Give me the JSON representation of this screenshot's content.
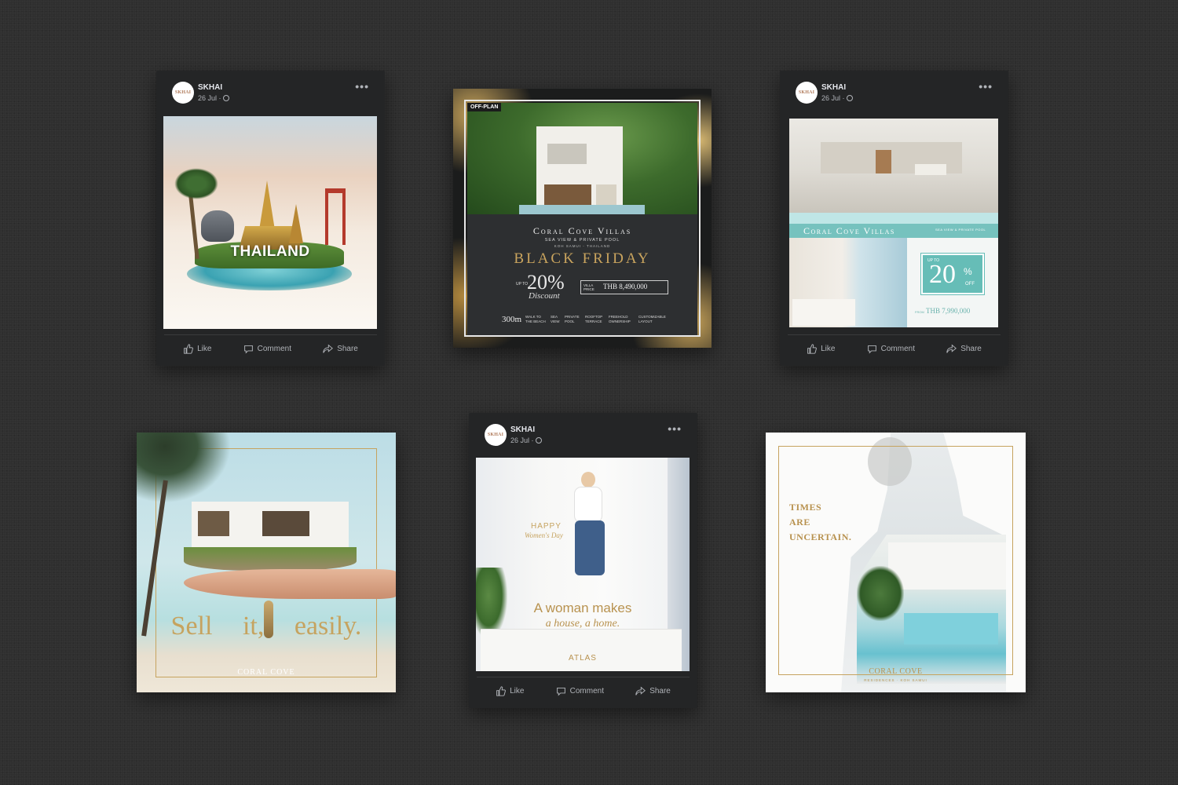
{
  "posts": {
    "thailand": {
      "page_name": "SKHAI",
      "avatar_text": "SKHAI",
      "date": "26 Jul ·",
      "banner_text": "THAILAND",
      "actions": {
        "like": "Like",
        "comment": "Comment",
        "share": "Share"
      }
    },
    "black_friday": {
      "tag": "OFF-PLAN",
      "brand": "Coral Cove Villas",
      "subtitle": "SEA VIEW & PRIVATE POOL",
      "location": "KOH SAMUI - THAILAND",
      "headline": "BLACK FRIDAY",
      "up_to": "UP TO",
      "discount": "20%",
      "discount_word": "Discount",
      "price_label": "VILLA PRICE",
      "price": "THB 8,490,000",
      "distance": "300m",
      "features": [
        "WALK TO THE BEACH",
        "SEA VIEW",
        "PRIVATE POOL",
        "ROOFTOP TERRACE",
        "FREEHOLD OWNERSHIP",
        "CUSTOMIZABLE LAYOUT"
      ]
    },
    "coral_interior": {
      "page_name": "SKHAI",
      "avatar_text": "SKHAI",
      "date": "26 Jul ·",
      "brand": "Coral Cove Villas",
      "subtitle": "SEA VIEW & PRIVATE POOL",
      "up_to": "UP TO",
      "discount": "20",
      "percent": "%",
      "off": "OFF",
      "price_from": "FROM",
      "price": "THB 7,990,000",
      "actions": {
        "like": "Like",
        "comment": "Comment",
        "share": "Share"
      }
    },
    "sell_it": {
      "headline": "Sell it, easily.",
      "brand": "CORAL COVE"
    },
    "woman": {
      "page_name": "SKHAI",
      "avatar_text": "SKHAI",
      "date": "26 Jul ·",
      "happy": "HAPPY",
      "womens_day": "Women's Day",
      "headline": "A woman makes",
      "subline": "a house, a home.",
      "logo": "ATLAS",
      "actions": {
        "like": "Like",
        "comment": "Comment",
        "share": "Share"
      }
    },
    "times": {
      "line1": "TIMES",
      "line2": "ARE",
      "line3": "UNCERTAIN.",
      "brand": "CORAL COVE",
      "brand_sub": "RESIDENCES · KOH SAMUI"
    }
  },
  "colors": {
    "background": "#2f2f2f",
    "card": "#242526",
    "gold": "#b8955a",
    "teal": "#6cc3c0"
  }
}
